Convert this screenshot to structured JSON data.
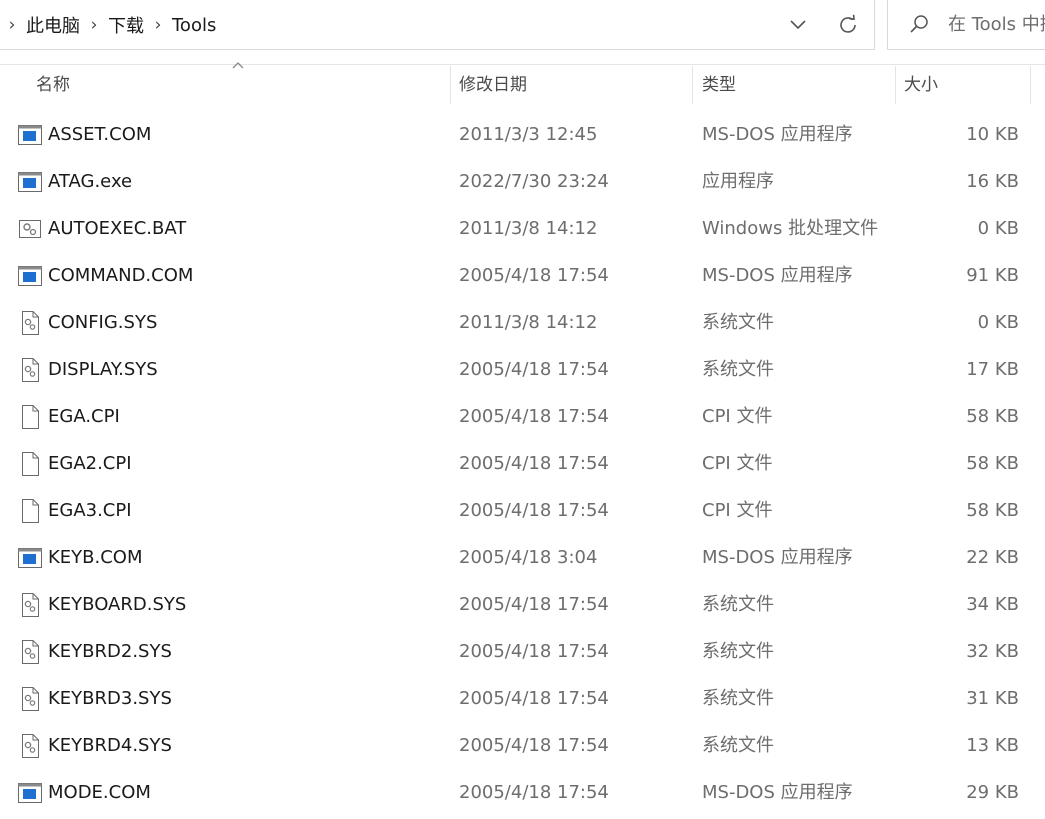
{
  "breadcrumb": [
    "此电脑",
    "下载",
    "Tools"
  ],
  "search": {
    "placeholder": "在 Tools 中搜"
  },
  "columns": {
    "name": "名称",
    "date": "修改日期",
    "type": "类型",
    "size": "大小"
  },
  "files": [
    {
      "name": "ASSET.COM",
      "date": "2011/3/3 12:45",
      "type": "MS-DOS 应用程序",
      "size": "10 KB",
      "icon": "app-window-icon"
    },
    {
      "name": "ATAG.exe",
      "date": "2022/7/30 23:24",
      "type": "应用程序",
      "size": "16 KB",
      "icon": "app-window-icon"
    },
    {
      "name": "AUTOEXEC.BAT",
      "date": "2011/3/8 14:12",
      "type": "Windows 批处理文件",
      "size": "0 KB",
      "icon": "batch-gear-icon"
    },
    {
      "name": "COMMAND.COM",
      "date": "2005/4/18 17:54",
      "type": "MS-DOS 应用程序",
      "size": "91 KB",
      "icon": "app-window-icon"
    },
    {
      "name": "CONFIG.SYS",
      "date": "2011/3/8 14:12",
      "type": "系统文件",
      "size": "0 KB",
      "icon": "system-file-icon"
    },
    {
      "name": "DISPLAY.SYS",
      "date": "2005/4/18 17:54",
      "type": "系统文件",
      "size": "17 KB",
      "icon": "system-file-icon"
    },
    {
      "name": "EGA.CPI",
      "date": "2005/4/18 17:54",
      "type": "CPI 文件",
      "size": "58 KB",
      "icon": "blank-file-icon"
    },
    {
      "name": "EGA2.CPI",
      "date": "2005/4/18 17:54",
      "type": "CPI 文件",
      "size": "58 KB",
      "icon": "blank-file-icon"
    },
    {
      "name": "EGA3.CPI",
      "date": "2005/4/18 17:54",
      "type": "CPI 文件",
      "size": "58 KB",
      "icon": "blank-file-icon"
    },
    {
      "name": "KEYB.COM",
      "date": "2005/4/18 3:04",
      "type": "MS-DOS 应用程序",
      "size": "22 KB",
      "icon": "app-window-icon"
    },
    {
      "name": "KEYBOARD.SYS",
      "date": "2005/4/18 17:54",
      "type": "系统文件",
      "size": "34 KB",
      "icon": "system-file-icon"
    },
    {
      "name": "KEYBRD2.SYS",
      "date": "2005/4/18 17:54",
      "type": "系统文件",
      "size": "32 KB",
      "icon": "system-file-icon"
    },
    {
      "name": "KEYBRD3.SYS",
      "date": "2005/4/18 17:54",
      "type": "系统文件",
      "size": "31 KB",
      "icon": "system-file-icon"
    },
    {
      "name": "KEYBRD4.SYS",
      "date": "2005/4/18 17:54",
      "type": "系统文件",
      "size": "13 KB",
      "icon": "system-file-icon"
    },
    {
      "name": "MODE.COM",
      "date": "2005/4/18 17:54",
      "type": "MS-DOS 应用程序",
      "size": "29 KB",
      "icon": "app-window-icon"
    }
  ]
}
